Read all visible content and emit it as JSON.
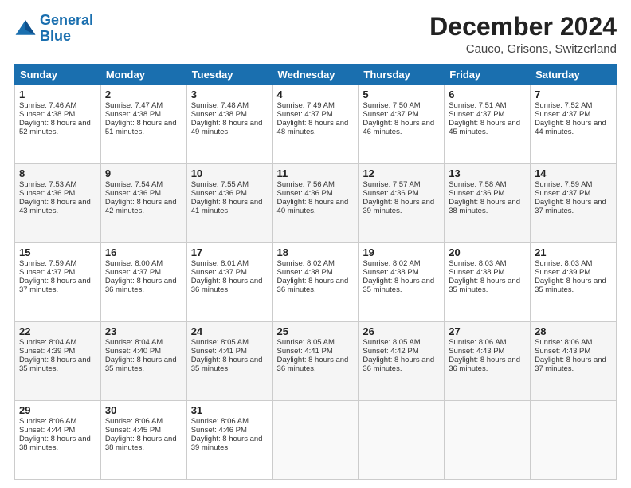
{
  "logo": {
    "line1": "General",
    "line2": "Blue"
  },
  "title": "December 2024",
  "subtitle": "Cauco, Grisons, Switzerland",
  "days_header": [
    "Sunday",
    "Monday",
    "Tuesday",
    "Wednesday",
    "Thursday",
    "Friday",
    "Saturday"
  ],
  "weeks": [
    [
      {
        "day": 1,
        "sunrise": "7:46 AM",
        "sunset": "4:38 PM",
        "daylight": "8 hours and 52 minutes."
      },
      {
        "day": 2,
        "sunrise": "7:47 AM",
        "sunset": "4:38 PM",
        "daylight": "8 hours and 51 minutes."
      },
      {
        "day": 3,
        "sunrise": "7:48 AM",
        "sunset": "4:38 PM",
        "daylight": "8 hours and 49 minutes."
      },
      {
        "day": 4,
        "sunrise": "7:49 AM",
        "sunset": "4:37 PM",
        "daylight": "8 hours and 48 minutes."
      },
      {
        "day": 5,
        "sunrise": "7:50 AM",
        "sunset": "4:37 PM",
        "daylight": "8 hours and 46 minutes."
      },
      {
        "day": 6,
        "sunrise": "7:51 AM",
        "sunset": "4:37 PM",
        "daylight": "8 hours and 45 minutes."
      },
      {
        "day": 7,
        "sunrise": "7:52 AM",
        "sunset": "4:37 PM",
        "daylight": "8 hours and 44 minutes."
      }
    ],
    [
      {
        "day": 8,
        "sunrise": "7:53 AM",
        "sunset": "4:36 PM",
        "daylight": "8 hours and 43 minutes."
      },
      {
        "day": 9,
        "sunrise": "7:54 AM",
        "sunset": "4:36 PM",
        "daylight": "8 hours and 42 minutes."
      },
      {
        "day": 10,
        "sunrise": "7:55 AM",
        "sunset": "4:36 PM",
        "daylight": "8 hours and 41 minutes."
      },
      {
        "day": 11,
        "sunrise": "7:56 AM",
        "sunset": "4:36 PM",
        "daylight": "8 hours and 40 minutes."
      },
      {
        "day": 12,
        "sunrise": "7:57 AM",
        "sunset": "4:36 PM",
        "daylight": "8 hours and 39 minutes."
      },
      {
        "day": 13,
        "sunrise": "7:58 AM",
        "sunset": "4:36 PM",
        "daylight": "8 hours and 38 minutes."
      },
      {
        "day": 14,
        "sunrise": "7:59 AM",
        "sunset": "4:37 PM",
        "daylight": "8 hours and 37 minutes."
      }
    ],
    [
      {
        "day": 15,
        "sunrise": "7:59 AM",
        "sunset": "4:37 PM",
        "daylight": "8 hours and 37 minutes."
      },
      {
        "day": 16,
        "sunrise": "8:00 AM",
        "sunset": "4:37 PM",
        "daylight": "8 hours and 36 minutes."
      },
      {
        "day": 17,
        "sunrise": "8:01 AM",
        "sunset": "4:37 PM",
        "daylight": "8 hours and 36 minutes."
      },
      {
        "day": 18,
        "sunrise": "8:02 AM",
        "sunset": "4:38 PM",
        "daylight": "8 hours and 36 minutes."
      },
      {
        "day": 19,
        "sunrise": "8:02 AM",
        "sunset": "4:38 PM",
        "daylight": "8 hours and 35 minutes."
      },
      {
        "day": 20,
        "sunrise": "8:03 AM",
        "sunset": "4:38 PM",
        "daylight": "8 hours and 35 minutes."
      },
      {
        "day": 21,
        "sunrise": "8:03 AM",
        "sunset": "4:39 PM",
        "daylight": "8 hours and 35 minutes."
      }
    ],
    [
      {
        "day": 22,
        "sunrise": "8:04 AM",
        "sunset": "4:39 PM",
        "daylight": "8 hours and 35 minutes."
      },
      {
        "day": 23,
        "sunrise": "8:04 AM",
        "sunset": "4:40 PM",
        "daylight": "8 hours and 35 minutes."
      },
      {
        "day": 24,
        "sunrise": "8:05 AM",
        "sunset": "4:41 PM",
        "daylight": "8 hours and 35 minutes."
      },
      {
        "day": 25,
        "sunrise": "8:05 AM",
        "sunset": "4:41 PM",
        "daylight": "8 hours and 36 minutes."
      },
      {
        "day": 26,
        "sunrise": "8:05 AM",
        "sunset": "4:42 PM",
        "daylight": "8 hours and 36 minutes."
      },
      {
        "day": 27,
        "sunrise": "8:06 AM",
        "sunset": "4:43 PM",
        "daylight": "8 hours and 36 minutes."
      },
      {
        "day": 28,
        "sunrise": "8:06 AM",
        "sunset": "4:43 PM",
        "daylight": "8 hours and 37 minutes."
      }
    ],
    [
      {
        "day": 29,
        "sunrise": "8:06 AM",
        "sunset": "4:44 PM",
        "daylight": "8 hours and 38 minutes."
      },
      {
        "day": 30,
        "sunrise": "8:06 AM",
        "sunset": "4:45 PM",
        "daylight": "8 hours and 38 minutes."
      },
      {
        "day": 31,
        "sunrise": "8:06 AM",
        "sunset": "4:46 PM",
        "daylight": "8 hours and 39 minutes."
      },
      null,
      null,
      null,
      null
    ]
  ]
}
